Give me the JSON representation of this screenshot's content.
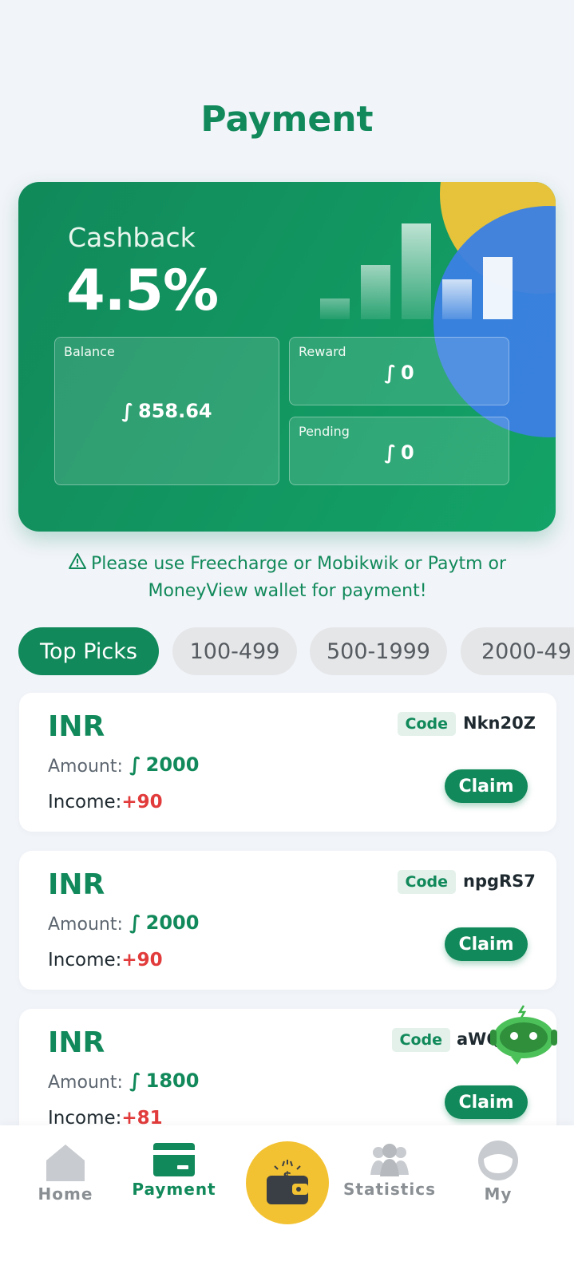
{
  "page": {
    "title": "Payment"
  },
  "hero": {
    "cashback_label": "Cashback",
    "cashback_value": "4.5%",
    "currency_symbol": "∫",
    "balance_label": "Balance",
    "balance_value": "858.64",
    "reward_label": "Reward",
    "reward_value": "0",
    "pending_label": "Pending",
    "pending_value": "0"
  },
  "notice": {
    "icon": "warning-icon",
    "text": "Please use Freecharge or Mobikwik or Paytm or MoneyView wallet for payment!"
  },
  "tabs": [
    {
      "label": "Top Picks",
      "active": true
    },
    {
      "label": "100-499",
      "active": false
    },
    {
      "label": "500-1999",
      "active": false
    },
    {
      "label": "2000-49",
      "active": false
    }
  ],
  "offers": [
    {
      "currency": "INR",
      "amount_label": "Amount:",
      "amount": "2000",
      "income_label": "Income:",
      "income": "+90",
      "code_label": "Code",
      "code": "Nkn20Z",
      "claim_label": "Claim"
    },
    {
      "currency": "INR",
      "amount_label": "Amount:",
      "amount": "2000",
      "income_label": "Income:",
      "income": "+90",
      "code_label": "Code",
      "code": "npgRS7",
      "claim_label": "Claim"
    },
    {
      "currency": "INR",
      "amount_label": "Amount:",
      "amount": "1800",
      "income_label": "Income:",
      "income": "+81",
      "code_label": "Code",
      "code": "aWQb",
      "claim_label": "Claim"
    }
  ],
  "nav": [
    {
      "label": "Home",
      "icon": "home-icon",
      "active": false
    },
    {
      "label": "Payment",
      "icon": "card-icon",
      "active": true
    },
    {
      "label": "",
      "icon": "wallet-icon",
      "active": false
    },
    {
      "label": "Statistics",
      "icon": "users-icon",
      "active": false
    },
    {
      "label": "My",
      "icon": "profile-icon",
      "active": false
    }
  ],
  "colors": {
    "brand": "#11895a",
    "accent_yellow": "#f3c232",
    "income_red": "#e23b3b",
    "hero_blue": "#3b7fe4"
  }
}
